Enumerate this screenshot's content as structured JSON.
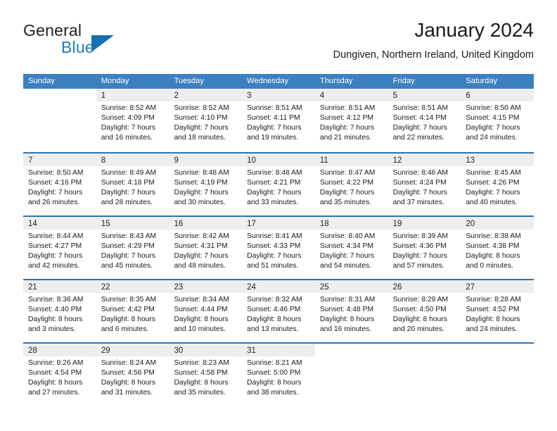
{
  "brand": {
    "name_top": "General",
    "name_bottom": "Blue",
    "accent_color": "#1a7fc1"
  },
  "header": {
    "title": "January 2024",
    "subtitle": "Dungiven, Northern Ireland, United Kingdom"
  },
  "calendar": {
    "header_color": "#3c80c0",
    "row_divider_color": "#2f73b4",
    "day_band_color": "#eeeeee",
    "weekdays": [
      "Sunday",
      "Monday",
      "Tuesday",
      "Wednesday",
      "Thursday",
      "Friday",
      "Saturday"
    ],
    "weeks": [
      [
        {
          "day": "",
          "lines": []
        },
        {
          "day": "1",
          "lines": [
            "Sunrise: 8:52 AM",
            "Sunset: 4:09 PM",
            "Daylight: 7 hours",
            "and 16 minutes."
          ]
        },
        {
          "day": "2",
          "lines": [
            "Sunrise: 8:52 AM",
            "Sunset: 4:10 PM",
            "Daylight: 7 hours",
            "and 18 minutes."
          ]
        },
        {
          "day": "3",
          "lines": [
            "Sunrise: 8:51 AM",
            "Sunset: 4:11 PM",
            "Daylight: 7 hours",
            "and 19 minutes."
          ]
        },
        {
          "day": "4",
          "lines": [
            "Sunrise: 8:51 AM",
            "Sunset: 4:12 PM",
            "Daylight: 7 hours",
            "and 21 minutes."
          ]
        },
        {
          "day": "5",
          "lines": [
            "Sunrise: 8:51 AM",
            "Sunset: 4:14 PM",
            "Daylight: 7 hours",
            "and 22 minutes."
          ]
        },
        {
          "day": "6",
          "lines": [
            "Sunrise: 8:50 AM",
            "Sunset: 4:15 PM",
            "Daylight: 7 hours",
            "and 24 minutes."
          ]
        }
      ],
      [
        {
          "day": "7",
          "lines": [
            "Sunrise: 8:50 AM",
            "Sunset: 4:16 PM",
            "Daylight: 7 hours",
            "and 26 minutes."
          ]
        },
        {
          "day": "8",
          "lines": [
            "Sunrise: 8:49 AM",
            "Sunset: 4:18 PM",
            "Daylight: 7 hours",
            "and 28 minutes."
          ]
        },
        {
          "day": "9",
          "lines": [
            "Sunrise: 8:48 AM",
            "Sunset: 4:19 PM",
            "Daylight: 7 hours",
            "and 30 minutes."
          ]
        },
        {
          "day": "10",
          "lines": [
            "Sunrise: 8:48 AM",
            "Sunset: 4:21 PM",
            "Daylight: 7 hours",
            "and 33 minutes."
          ]
        },
        {
          "day": "11",
          "lines": [
            "Sunrise: 8:47 AM",
            "Sunset: 4:22 PM",
            "Daylight: 7 hours",
            "and 35 minutes."
          ]
        },
        {
          "day": "12",
          "lines": [
            "Sunrise: 8:46 AM",
            "Sunset: 4:24 PM",
            "Daylight: 7 hours",
            "and 37 minutes."
          ]
        },
        {
          "day": "13",
          "lines": [
            "Sunrise: 8:45 AM",
            "Sunset: 4:26 PM",
            "Daylight: 7 hours",
            "and 40 minutes."
          ]
        }
      ],
      [
        {
          "day": "14",
          "lines": [
            "Sunrise: 8:44 AM",
            "Sunset: 4:27 PM",
            "Daylight: 7 hours",
            "and 42 minutes."
          ]
        },
        {
          "day": "15",
          "lines": [
            "Sunrise: 8:43 AM",
            "Sunset: 4:29 PM",
            "Daylight: 7 hours",
            "and 45 minutes."
          ]
        },
        {
          "day": "16",
          "lines": [
            "Sunrise: 8:42 AM",
            "Sunset: 4:31 PM",
            "Daylight: 7 hours",
            "and 48 minutes."
          ]
        },
        {
          "day": "17",
          "lines": [
            "Sunrise: 8:41 AM",
            "Sunset: 4:33 PM",
            "Daylight: 7 hours",
            "and 51 minutes."
          ]
        },
        {
          "day": "18",
          "lines": [
            "Sunrise: 8:40 AM",
            "Sunset: 4:34 PM",
            "Daylight: 7 hours",
            "and 54 minutes."
          ]
        },
        {
          "day": "19",
          "lines": [
            "Sunrise: 8:39 AM",
            "Sunset: 4:36 PM",
            "Daylight: 7 hours",
            "and 57 minutes."
          ]
        },
        {
          "day": "20",
          "lines": [
            "Sunrise: 8:38 AM",
            "Sunset: 4:38 PM",
            "Daylight: 8 hours",
            "and 0 minutes."
          ]
        }
      ],
      [
        {
          "day": "21",
          "lines": [
            "Sunrise: 8:36 AM",
            "Sunset: 4:40 PM",
            "Daylight: 8 hours",
            "and 3 minutes."
          ]
        },
        {
          "day": "22",
          "lines": [
            "Sunrise: 8:35 AM",
            "Sunset: 4:42 PM",
            "Daylight: 8 hours",
            "and 6 minutes."
          ]
        },
        {
          "day": "23",
          "lines": [
            "Sunrise: 8:34 AM",
            "Sunset: 4:44 PM",
            "Daylight: 8 hours",
            "and 10 minutes."
          ]
        },
        {
          "day": "24",
          "lines": [
            "Sunrise: 8:32 AM",
            "Sunset: 4:46 PM",
            "Daylight: 8 hours",
            "and 13 minutes."
          ]
        },
        {
          "day": "25",
          "lines": [
            "Sunrise: 8:31 AM",
            "Sunset: 4:48 PM",
            "Daylight: 8 hours",
            "and 16 minutes."
          ]
        },
        {
          "day": "26",
          "lines": [
            "Sunrise: 8:29 AM",
            "Sunset: 4:50 PM",
            "Daylight: 8 hours",
            "and 20 minutes."
          ]
        },
        {
          "day": "27",
          "lines": [
            "Sunrise: 8:28 AM",
            "Sunset: 4:52 PM",
            "Daylight: 8 hours",
            "and 24 minutes."
          ]
        }
      ],
      [
        {
          "day": "28",
          "lines": [
            "Sunrise: 8:26 AM",
            "Sunset: 4:54 PM",
            "Daylight: 8 hours",
            "and 27 minutes."
          ]
        },
        {
          "day": "29",
          "lines": [
            "Sunrise: 8:24 AM",
            "Sunset: 4:56 PM",
            "Daylight: 8 hours",
            "and 31 minutes."
          ]
        },
        {
          "day": "30",
          "lines": [
            "Sunrise: 8:23 AM",
            "Sunset: 4:58 PM",
            "Daylight: 8 hours",
            "and 35 minutes."
          ]
        },
        {
          "day": "31",
          "lines": [
            "Sunrise: 8:21 AM",
            "Sunset: 5:00 PM",
            "Daylight: 8 hours",
            "and 38 minutes."
          ]
        },
        {
          "day": "",
          "lines": []
        },
        {
          "day": "",
          "lines": []
        },
        {
          "day": "",
          "lines": []
        }
      ]
    ]
  }
}
